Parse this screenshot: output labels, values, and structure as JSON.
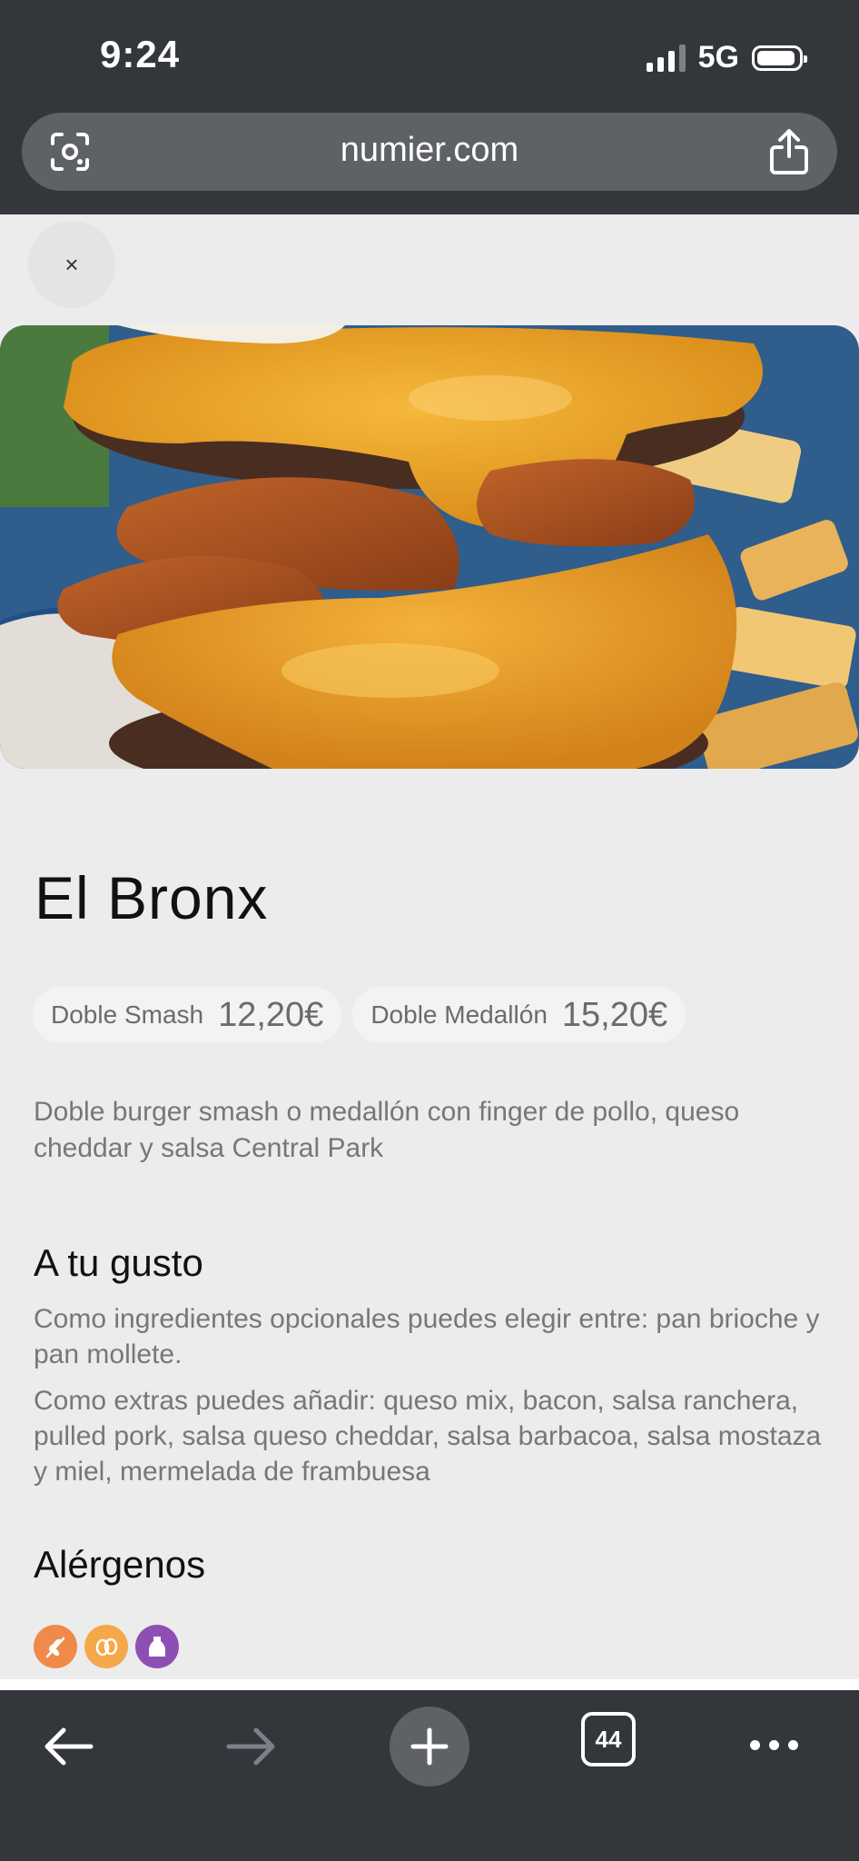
{
  "status_bar": {
    "time": "9:24",
    "network": "5G"
  },
  "browser": {
    "url": "numier.com",
    "open_tabs": "44"
  },
  "close_button": {
    "label": "×"
  },
  "product": {
    "name": "El Bronx",
    "prices": [
      {
        "label": "Doble Smash",
        "value": "12,20€"
      },
      {
        "label": "Doble Medallón",
        "value": "15,20€"
      }
    ],
    "description": "Doble burger smash o medallón con finger de pollo, queso cheddar y salsa Central Park"
  },
  "customize": {
    "title": "A tu gusto",
    "optional_text": "Como ingredientes opcionales puedes elegir entre: pan brioche y pan mollete.",
    "extras_text": "Como extras puedes añadir: queso mix, bacon, salsa ranchera, pulled pork, salsa queso cheddar, salsa barbacoa, salsa mostaza y miel, mermelada de frambuesa"
  },
  "allergens": {
    "title": "Alérgenos",
    "items": [
      {
        "icon": "gluten-icon",
        "color": "#f08a4b"
      },
      {
        "icon": "egg-icon",
        "color": "#f5a84a"
      },
      {
        "icon": "dairy-icon",
        "color": "#8e4fb5"
      }
    ]
  }
}
